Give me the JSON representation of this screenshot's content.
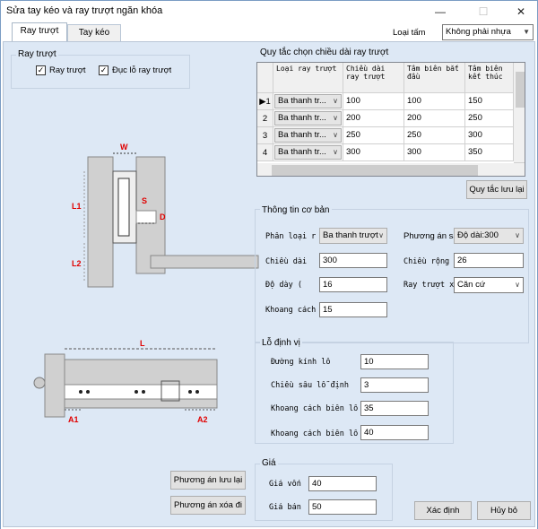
{
  "window": {
    "title": "Sửa tay kéo và ray trượt ngăn khóa",
    "minimize": "—",
    "maximize": "☐",
    "close": "✕"
  },
  "tabs": [
    {
      "label": "Ray trượt",
      "active": true
    },
    {
      "label": "Tay kéo",
      "active": false
    }
  ],
  "header": {
    "loai_tam_label": "Loại tấm",
    "loai_tam_value": "Không phải nhựa"
  },
  "ray_truot_group": {
    "title": "Ray trượt",
    "check1": {
      "label": "Ray trượt",
      "checked": true
    },
    "check2": {
      "label": "Đục lỗ ray trượt",
      "checked": true
    }
  },
  "drawing1": {
    "W": "W",
    "S": "S",
    "D": "D",
    "L1": "L1",
    "L2": "L2"
  },
  "drawing2": {
    "L": "L",
    "A1": "A1",
    "A2": "A2"
  },
  "rules_group": {
    "title": "Quy tắc chọn chiều dài ray trượt",
    "columns": [
      "Loại ray trượt",
      "Chiều dài ray trượt",
      "Tâm biên bắt đầu",
      "Tâm biên kết thúc"
    ],
    "rows": [
      {
        "idx": "▶1",
        "type": "Ba thanh tr...",
        "length": "100",
        "start": "100",
        "end": "150"
      },
      {
        "idx": "2",
        "type": "Ba thanh tr...",
        "length": "200",
        "start": "200",
        "end": "250"
      },
      {
        "idx": "3",
        "type": "Ba thanh tr...",
        "length": "250",
        "start": "250",
        "end": "300"
      },
      {
        "idx": "4",
        "type": "Ba thanh tr...",
        "length": "300",
        "start": "300",
        "end": "350"
      }
    ],
    "save_rule_button": "Quy tắc lưu lại"
  },
  "basic_info": {
    "title": "Thông tin cơ bản",
    "phan_loai_label": "Phân loại r",
    "phan_loai_value": "Ba thanh trượt",
    "phuong_an_label": "Phương án sắ",
    "phuong_an_value": "Độ dài:300",
    "chieu_dai_label": "Chiều dài",
    "chieu_dai_value": "300",
    "chieu_rong_label": "Chiều rộng",
    "chieu_rong_value": "26",
    "do_day_label": "Độ dày (",
    "do_day_value": "16",
    "ray_truot_x_label": "Ray trượt xé",
    "ray_truot_x_value": "Căn cứ",
    "khoang_cach_label": "Khoang cách",
    "khoang_cach_value": "15"
  },
  "lo_dinh_vi": {
    "title": "Lỗ định vị",
    "duong_kinh_label": "Đường kính lỗ",
    "duong_kinh_value": "10",
    "chieu_sau_label": "Chiều sâu lỗ định",
    "chieu_sau_value": "3",
    "khoang_cach1_label": "Khoang cách biên lỗ",
    "khoang_cach1_value": "35",
    "khoang_cach2_label": "Khoang cách biên lỗ",
    "khoang_cach2_value": "40"
  },
  "gia": {
    "title": "Giá",
    "gia_von_label": "Giá vốn",
    "gia_von_value": "40",
    "gia_ban_label": "Giá bán",
    "gia_ban_value": "50"
  },
  "buttons": {
    "save_plan": "Phương án lưu lại",
    "delete_plan": "Phương án xóa đi",
    "confirm": "Xác định",
    "cancel": "Hủy bỏ"
  }
}
